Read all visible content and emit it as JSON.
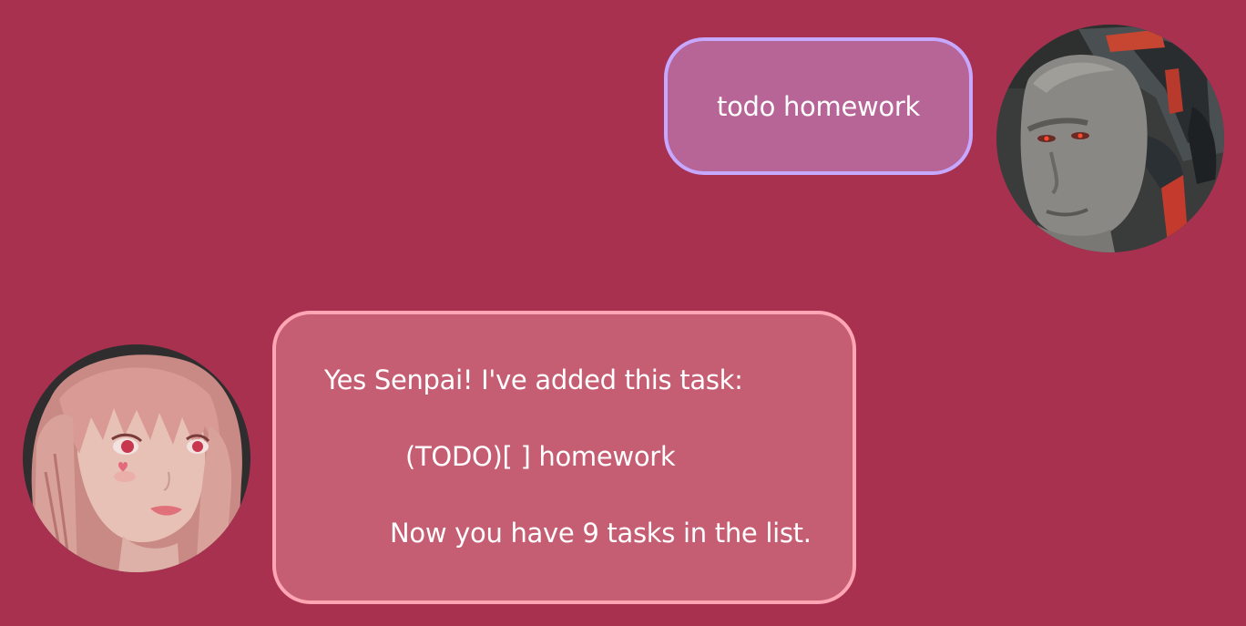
{
  "colors": {
    "background": "#a83150",
    "user_bubble_fill": "#b76497",
    "user_bubble_border": "#c6a8ff",
    "bot_bubble_fill": "#c65e73",
    "bot_bubble_border": "#ffa5b4"
  },
  "messages": [
    {
      "sender": "user",
      "avatar_icon": "cyborg-man-avatar",
      "text": "todo homework"
    },
    {
      "sender": "bot",
      "avatar_icon": "pink-hair-girl-avatar",
      "lines": [
        "Yes Senpai! I've added this task:",
        "(TODO)[ ] homework",
        "Now you have 9 tasks in the list."
      ]
    }
  ]
}
